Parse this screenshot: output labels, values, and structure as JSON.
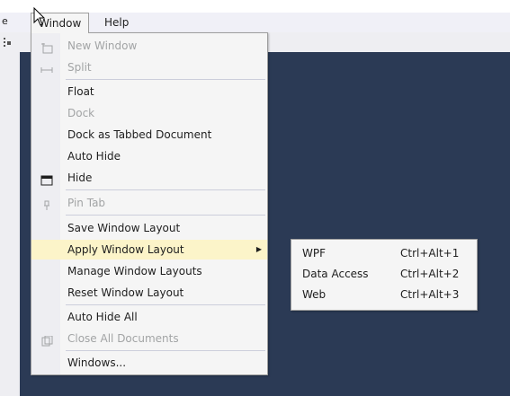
{
  "menubar": {
    "partial_left_label": "e",
    "window_label": "Window",
    "help_label": "Help"
  },
  "window_menu": {
    "items": [
      {
        "label": "New Window",
        "enabled": false,
        "icon": "new-window-icon"
      },
      {
        "label": "Split",
        "enabled": false,
        "icon": "split-icon"
      },
      {
        "label": "Float",
        "enabled": true
      },
      {
        "label": "Dock",
        "enabled": false
      },
      {
        "label": "Dock as Tabbed Document",
        "enabled": true
      },
      {
        "label": "Auto Hide",
        "enabled": true
      },
      {
        "label": "Hide",
        "enabled": true,
        "icon": "hide-window-icon"
      },
      {
        "label": "Pin Tab",
        "enabled": false,
        "icon": "pin-icon"
      },
      {
        "label": "Save Window Layout",
        "enabled": true
      },
      {
        "label": "Apply Window Layout",
        "enabled": true,
        "highlighted": true,
        "submenu": true
      },
      {
        "label": "Manage Window Layouts",
        "enabled": true
      },
      {
        "label": "Reset Window Layout",
        "enabled": true
      },
      {
        "label": "Auto Hide All",
        "enabled": true
      },
      {
        "label": "Close All Documents",
        "enabled": false,
        "icon": "close-all-documents-icon"
      },
      {
        "label": "Windows...",
        "enabled": true
      }
    ]
  },
  "apply_layout_submenu": {
    "items": [
      {
        "label": "WPF",
        "shortcut": "Ctrl+Alt+1"
      },
      {
        "label": "Data Access",
        "shortcut": "Ctrl+Alt+2"
      },
      {
        "label": "Web",
        "shortcut": "Ctrl+Alt+3"
      }
    ]
  },
  "colors": {
    "editor_background": "#2b3a55",
    "menu_background": "#f5f5f5",
    "highlight": "#fcf4c9",
    "disabled_text": "#a2a4a5"
  }
}
